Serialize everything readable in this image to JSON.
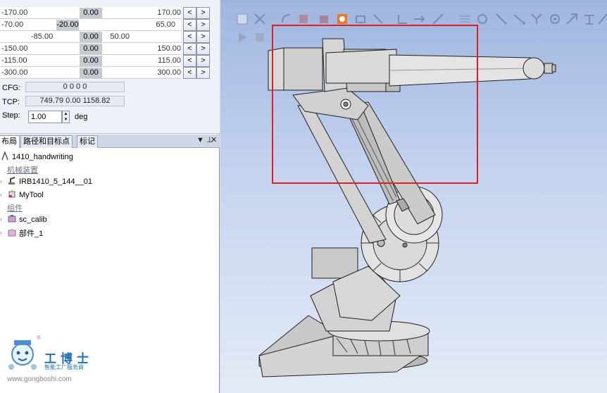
{
  "jog": {
    "rows": [
      {
        "min": "-170.00",
        "value": "0.00",
        "max": "170.00"
      },
      {
        "min": "-70.00",
        "value": "-20.00",
        "max": "65.00"
      },
      {
        "min": "-85.00",
        "value": "0.00",
        "max": "50.00"
      },
      {
        "min": "-150.00",
        "value": "0.00",
        "max": "150.00"
      },
      {
        "min": "-115.00",
        "value": "0.00",
        "max": "115.00"
      },
      {
        "min": "-300.00",
        "value": "0.00",
        "max": "300.00"
      }
    ],
    "dec_label": "<",
    "inc_label": ">",
    "cfg_label": "CFG:",
    "cfg_value": "0 0 0 0",
    "tcp_label": "TCP:",
    "tcp_value": "749.79 0.00 1158.82",
    "step_label": "Step:",
    "step_value": "1.00",
    "step_unit": "deg"
  },
  "tree": {
    "tabs": [
      "布局",
      "路径和目标点",
      "标记"
    ],
    "pin_icon": "pin-icon",
    "close_icon": "close-icon",
    "pin_glyph": "▼ ⊥",
    "close_glyph": "✕",
    "station": "1410_handwriting",
    "group_mech": "机械装置",
    "robot": "IRB1410_5_144__01",
    "tool": "MyTool",
    "group_comp": "组件",
    "comp1": "sc_calib",
    "comp2": "部件_1"
  },
  "watermark": {
    "brand": "工博士",
    "sub": "智能工厂服务商",
    "url": "www.gongboshi.com",
    "registered": "®"
  },
  "colors": {
    "selection": "#e02020",
    "viewport_top": "#9fb6e0",
    "viewport_bottom": "#e4ebf7",
    "brand": "#1f6fb3"
  }
}
